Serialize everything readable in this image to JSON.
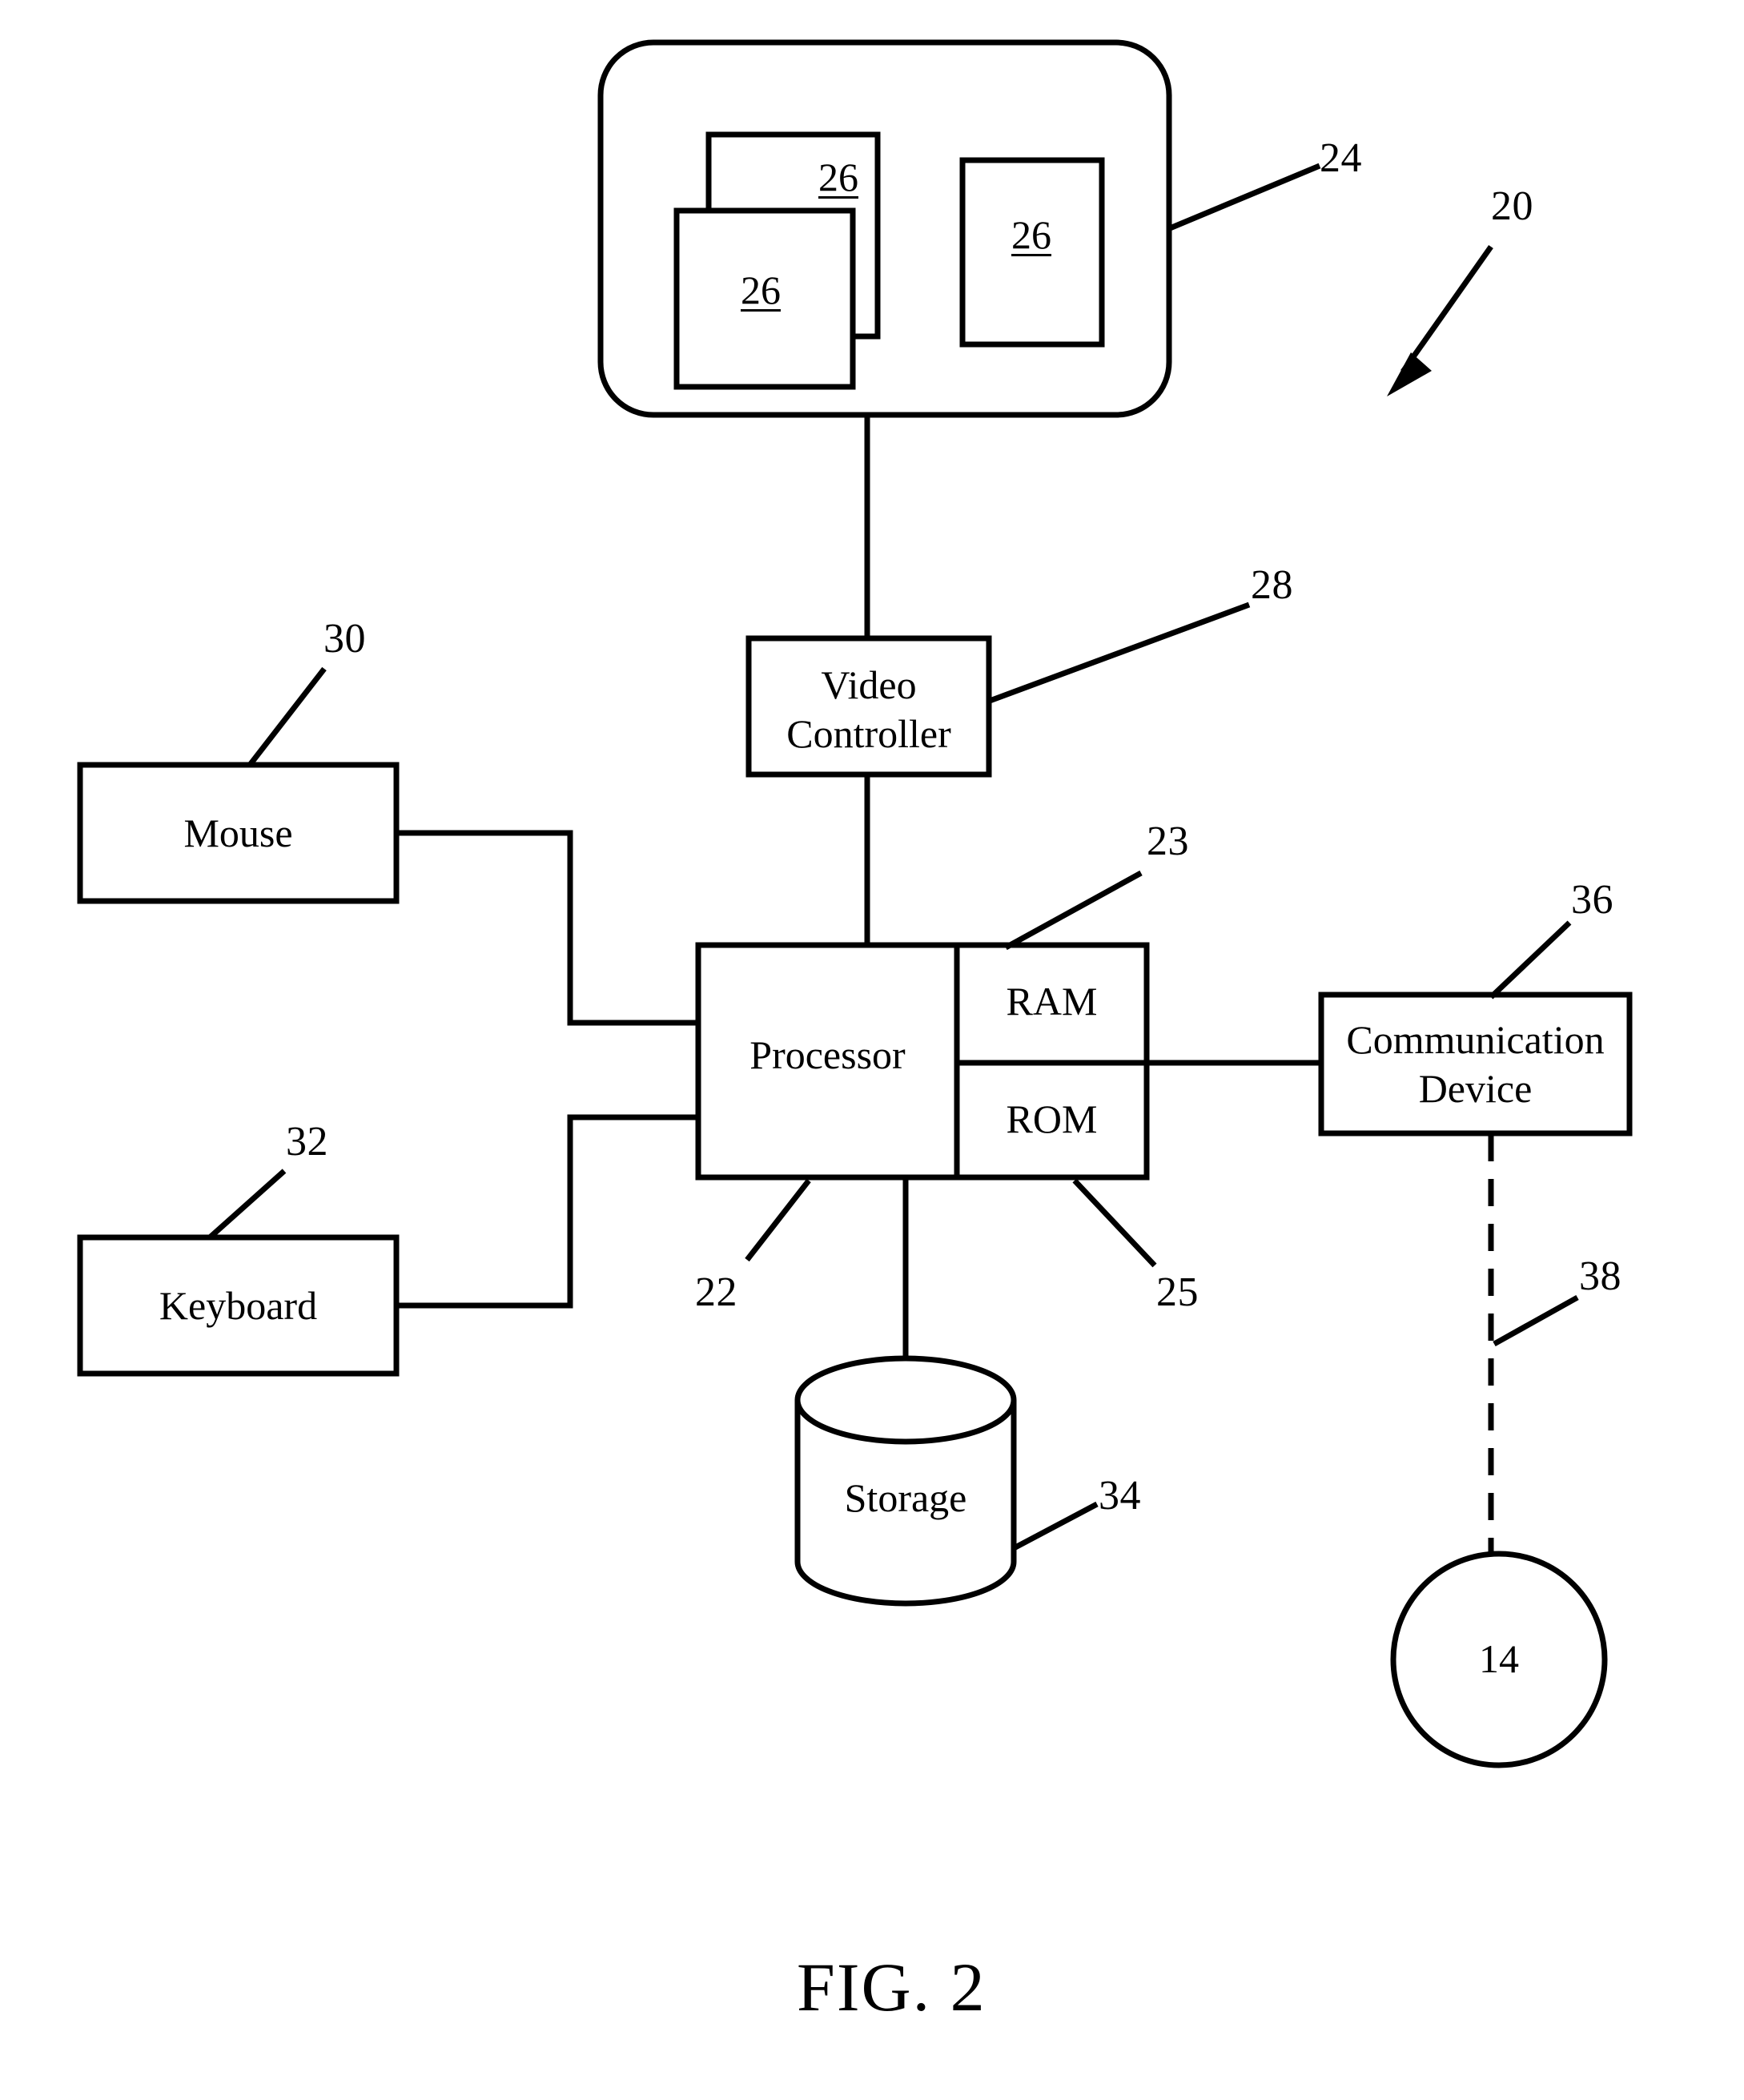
{
  "figure": {
    "caption": "FIG. 2",
    "system_ref": "20"
  },
  "display": {
    "ref": "24",
    "windows": [
      {
        "ref": "26",
        "position": "back-left"
      },
      {
        "ref": "26",
        "position": "front-left"
      },
      {
        "ref": "26",
        "position": "right"
      }
    ]
  },
  "blocks": {
    "video_controller": {
      "label_line1": "Video",
      "label_line2": "Controller",
      "ref": "28"
    },
    "mouse": {
      "label": "Mouse",
      "ref": "30"
    },
    "keyboard": {
      "label": "Keyboard",
      "ref": "32"
    },
    "processor": {
      "label": "Processor",
      "ref": "22"
    },
    "ram": {
      "label": "RAM",
      "ref": "23"
    },
    "rom": {
      "label": "ROM",
      "ref": "25"
    },
    "storage": {
      "label": "Storage",
      "ref": "34"
    },
    "communication_device": {
      "label_line1": "Communication",
      "label_line2": "Device",
      "ref": "36"
    },
    "network": {
      "label": "14"
    }
  },
  "connections": {
    "communication_link_ref": "38"
  },
  "style": {
    "stroke": "#000000",
    "background": "#ffffff"
  }
}
